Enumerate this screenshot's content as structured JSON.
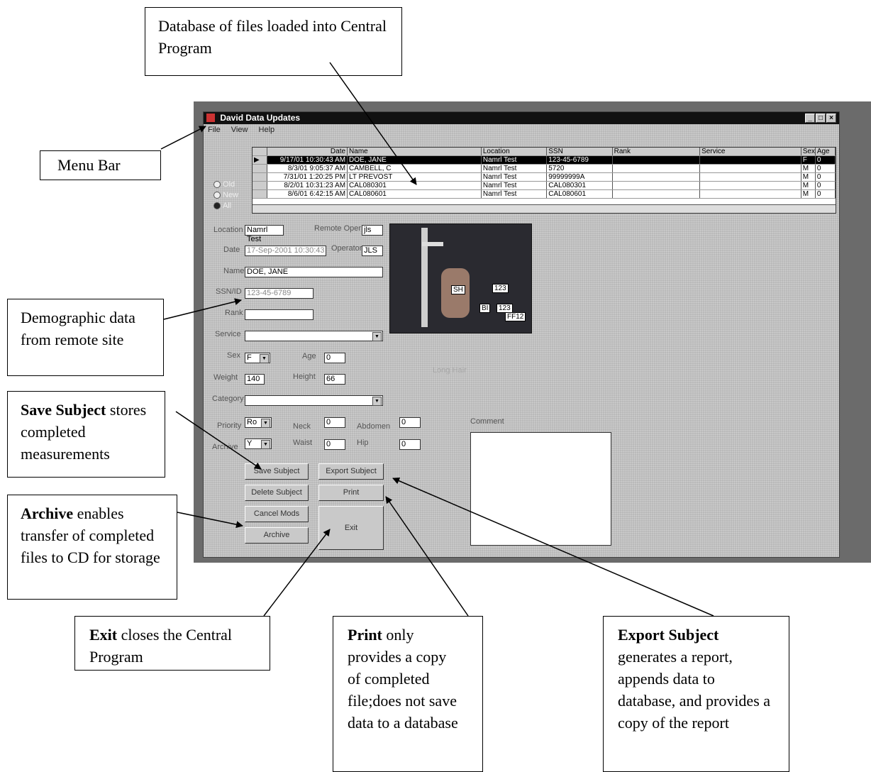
{
  "window": {
    "title": "David Data Updates",
    "menu": [
      "File",
      "View",
      "Help"
    ]
  },
  "grid": {
    "headers": [
      "Date",
      "Name",
      "Location",
      "SSN",
      "Rank",
      "Service",
      "Sex",
      "Age"
    ],
    "rows": [
      [
        "9/17/01 10:30:43 AM",
        "DOE, JANE",
        "Namrl Test",
        "123-45-6789",
        "",
        "",
        "F",
        "0"
      ],
      [
        "8/3/01 9:05:37 AM",
        "CAMBELL, C",
        "Namrl Test",
        "5720",
        "",
        "",
        "M",
        "0"
      ],
      [
        "7/31/01 1:20:25 PM",
        "LT PREVOST",
        "Namrl Test",
        "99999999A",
        "",
        "",
        "M",
        "0"
      ],
      [
        "8/2/01 10:31:23 AM",
        "CAL080301",
        "Namrl Test",
        "CAL080301",
        "",
        "",
        "M",
        "0"
      ],
      [
        "8/6/01 6:42:15 AM",
        "CAL080601",
        "Namrl Test",
        "CAL080601",
        "",
        "",
        "M",
        "0"
      ]
    ]
  },
  "filter": {
    "options": [
      "Old",
      "New",
      "All"
    ],
    "selected": "All"
  },
  "form": {
    "location_label": "Location",
    "location": "Namrl Test",
    "remote_oper_label": "Remote Oper",
    "remote_oper": "jls",
    "date_label": "Date",
    "date": "17-Sep-2001 10:30:43",
    "operator_label": "Operator",
    "operator": "JLS",
    "name_label": "Name",
    "name": "DOE, JANE",
    "ssn_label": "SSN/ID",
    "ssn": "123-45-6789",
    "rank_label": "Rank",
    "rank": "",
    "service_label": "Service",
    "service": "",
    "sex_label": "Sex",
    "sex": "F",
    "age_label": "Age",
    "age": "0",
    "weight_label": "Weight",
    "weight": "140",
    "height_label": "Height",
    "height": "66",
    "category_label": "Category",
    "category": "",
    "priority_label": "Priority",
    "priority": "Ro",
    "archive_label": "Archive",
    "archive": "Y",
    "neck_label": "Neck",
    "neck": "0",
    "waist_label": "Waist",
    "waist": "0",
    "abdomen_label": "Abdomen",
    "abdomen": "0",
    "hip_label": "Hip",
    "hip": "0",
    "comment_label": "Comment",
    "long_hair_label": "Long Hair"
  },
  "photo_tags": [
    "SH",
    "123",
    "BI",
    "123",
    "FF12"
  ],
  "buttons": {
    "save": "Save Subject",
    "export": "Export Subject",
    "delete": "Delete Subject",
    "print": "Print",
    "cancel": "Cancel Mods",
    "exit": "Exit",
    "archive": "Archive"
  },
  "callouts": {
    "database": "Database of files loaded into Central Program",
    "menu_bar": "Menu Bar",
    "demographic": "Demographic data from remote site",
    "save_bold": "Save Subject",
    "save_rest": "stores completed measurements",
    "archive_bold": "Archive",
    "archive_rest": "enables transfer of completed files to CD for storage",
    "exit_bold": "Exit",
    "exit_rest": "closes the Central Program",
    "print_bold": "Print",
    "print_rest": "only provides a copy of completed file;does not save data to a database",
    "export_bold": "Export Subject",
    "export_rest": "generates a report, appends data to database, and provides a copy of the report"
  }
}
